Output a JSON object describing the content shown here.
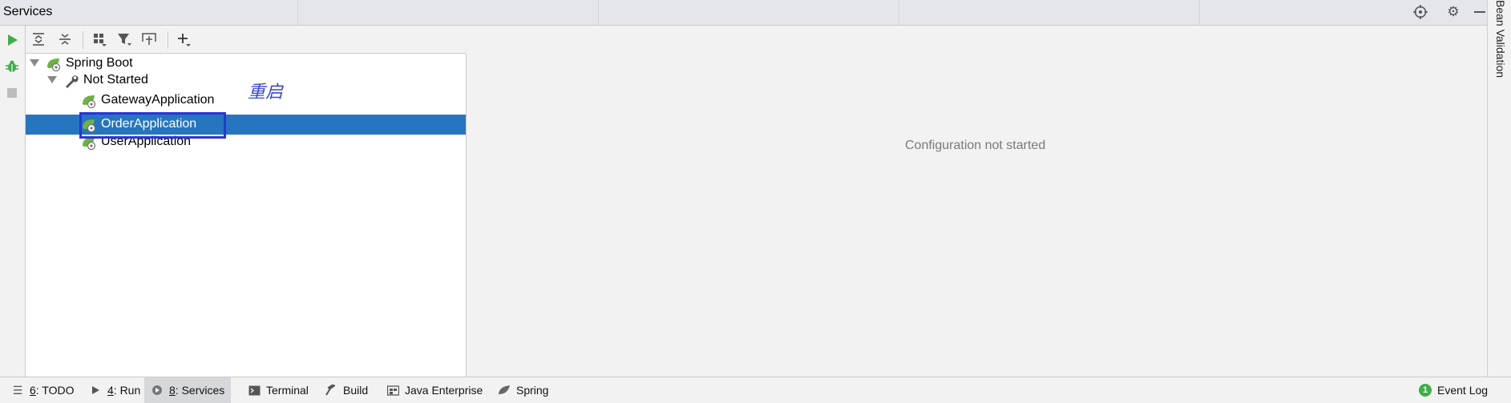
{
  "window": {
    "title": "Services"
  },
  "right_stripe": {
    "label": "Bean Validation"
  },
  "annotation": {
    "text": "重启"
  },
  "tree": {
    "items": [
      {
        "label": "Spring Boot"
      },
      {
        "label": "Not Started"
      },
      {
        "label": "GatewayApplication"
      },
      {
        "label": "OrderApplication"
      },
      {
        "label": "UserApplication"
      }
    ]
  },
  "detail": {
    "message": "Configuration not started"
  },
  "bottom_tabs": [
    {
      "key": "6",
      "rest": ": TODO"
    },
    {
      "key": "4",
      "rest": ": Run"
    },
    {
      "key": "8",
      "rest": ": Services"
    },
    {
      "label": "Terminal"
    },
    {
      "label": "Build"
    },
    {
      "label": "Java Enterprise"
    },
    {
      "label": "Spring"
    }
  ],
  "event_log": {
    "label": "Event Log",
    "count": "1"
  },
  "colors": {
    "selection": "#2675bf",
    "annotation": "#3846d6",
    "highlight_box": "#2b35d6",
    "run_green": "#3fae49"
  }
}
